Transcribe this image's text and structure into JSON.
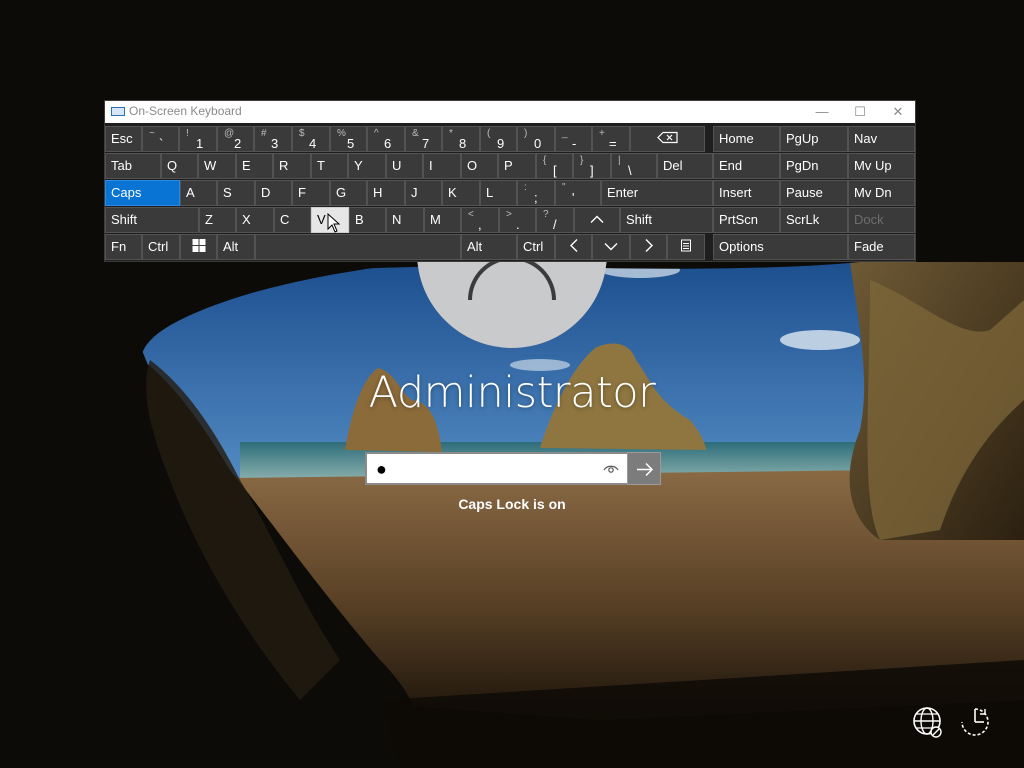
{
  "osk": {
    "title": "On-Screen Keyboard",
    "window_buttons": {
      "minimize": "—",
      "maximize": "☐",
      "close": "✕"
    },
    "rows": [
      [
        {
          "label": "Esc"
        },
        {
          "upper": "~",
          "lower": "`"
        },
        {
          "upper": "!",
          "lower": "1"
        },
        {
          "upper": "@",
          "lower": "2"
        },
        {
          "upper": "#",
          "lower": "3"
        },
        {
          "upper": "$",
          "lower": "4"
        },
        {
          "upper": "%",
          "lower": "5"
        },
        {
          "upper": "^",
          "lower": "6"
        },
        {
          "upper": "&",
          "lower": "7"
        },
        {
          "upper": "*",
          "lower": "8"
        },
        {
          "upper": "(",
          "lower": "9"
        },
        {
          "upper": ")",
          "lower": "0"
        },
        {
          "upper": "_",
          "lower": "-"
        },
        {
          "upper": "+",
          "lower": "="
        },
        {
          "icon": "backspace-icon"
        },
        {
          "label": "Home"
        },
        {
          "label": "PgUp"
        },
        {
          "label": "Nav"
        }
      ],
      [
        {
          "label": "Tab"
        },
        {
          "label": "Q"
        },
        {
          "label": "W"
        },
        {
          "label": "E"
        },
        {
          "label": "R"
        },
        {
          "label": "T"
        },
        {
          "label": "Y"
        },
        {
          "label": "U"
        },
        {
          "label": "I"
        },
        {
          "label": "O"
        },
        {
          "label": "P"
        },
        {
          "upper": "{",
          "lower": "["
        },
        {
          "upper": "}",
          "lower": "]"
        },
        {
          "upper": "|",
          "lower": "\\"
        },
        {
          "label": "Del"
        },
        {
          "label": "End"
        },
        {
          "label": "PgDn"
        },
        {
          "label": "Mv Up"
        }
      ],
      [
        {
          "label": "Caps",
          "state": "active"
        },
        {
          "label": "A"
        },
        {
          "label": "S"
        },
        {
          "label": "D"
        },
        {
          "label": "F"
        },
        {
          "label": "G"
        },
        {
          "label": "H"
        },
        {
          "label": "J"
        },
        {
          "label": "K"
        },
        {
          "label": "L"
        },
        {
          "upper": ":",
          "lower": ";"
        },
        {
          "upper": "\"",
          "lower": "'"
        },
        {
          "label": "Enter"
        },
        {
          "label": "Insert"
        },
        {
          "label": "Pause"
        },
        {
          "label": "Mv Dn"
        }
      ],
      [
        {
          "label": "Shift"
        },
        {
          "label": "Z"
        },
        {
          "label": "X"
        },
        {
          "label": "C"
        },
        {
          "label": "V",
          "state": "hover"
        },
        {
          "label": "B"
        },
        {
          "label": "N"
        },
        {
          "label": "M"
        },
        {
          "upper": "<",
          "lower": ","
        },
        {
          "upper": ">",
          "lower": "."
        },
        {
          "upper": "?",
          "lower": "/"
        },
        {
          "icon": "arrow-up-icon"
        },
        {
          "label": "Shift"
        },
        {
          "label": "PrtScn"
        },
        {
          "label": "ScrLk"
        },
        {
          "label": "Dock",
          "state": "dim"
        }
      ],
      [
        {
          "label": "Fn"
        },
        {
          "label": "Ctrl"
        },
        {
          "icon": "windows-icon"
        },
        {
          "label": "Alt"
        },
        {
          "label": ""
        },
        {
          "label": "Alt"
        },
        {
          "label": "Ctrl"
        },
        {
          "icon": "arrow-left-icon"
        },
        {
          "icon": "arrow-down-icon"
        },
        {
          "icon": "arrow-right-icon"
        },
        {
          "icon": "menu-key-icon"
        },
        {
          "label": "Options"
        },
        {
          "label": "Fade"
        }
      ]
    ]
  },
  "login": {
    "username": "Administrator",
    "password_mask": "●",
    "caps_lock_message": "Caps Lock is on"
  },
  "colors": {
    "accent": "#0a74d4",
    "key": "#3a3a3a",
    "keyboard_bg": "#1e1e1e"
  }
}
